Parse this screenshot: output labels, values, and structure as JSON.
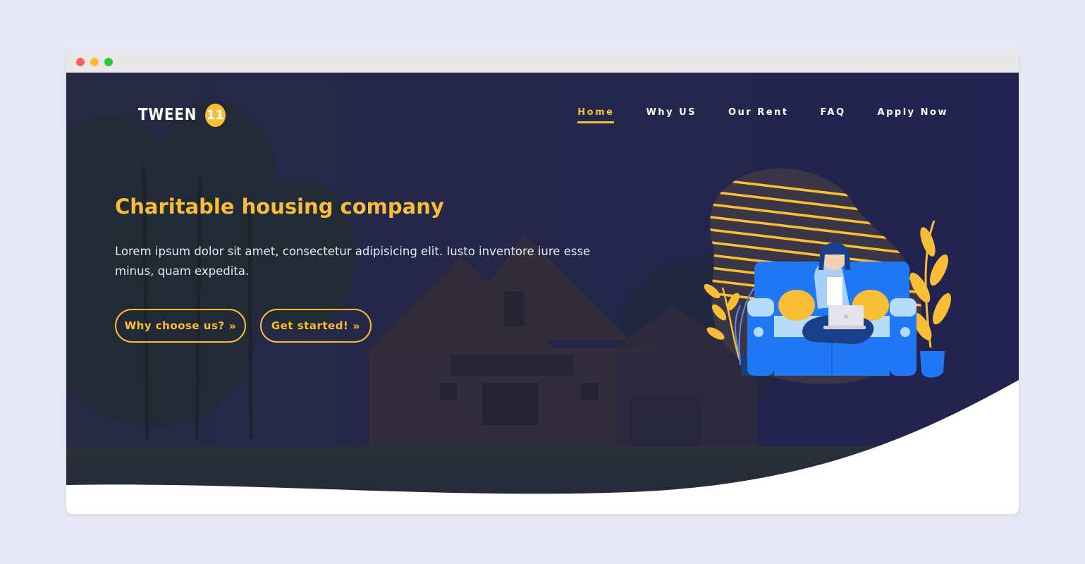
{
  "window": {
    "controls": [
      "close",
      "minimize",
      "maximize"
    ]
  },
  "header": {
    "logo_text": "TWEEN",
    "logo_badge": "11",
    "nav": [
      {
        "label": "Home",
        "active": true
      },
      {
        "label": "Why US",
        "active": false
      },
      {
        "label": "Our Rent",
        "active": false
      },
      {
        "label": "FAQ",
        "active": false
      },
      {
        "label": "Apply Now",
        "active": false
      }
    ]
  },
  "hero": {
    "title": "Charitable housing company",
    "description": "Lorem ipsum dolor sit amet, consectetur adipisicing elit. Iusto inventore iure esse minus, quam expedita.",
    "buttons": {
      "why_label": "Why choose us?",
      "start_label": "Get started!"
    },
    "icons": {
      "button_arrow": "double-chevron-right-icon",
      "illustration": "woman-on-sofa-with-laptop-illustration"
    }
  },
  "colors": {
    "accent": "#f9be37",
    "overlay": "#1f1f4d",
    "page_background": "#e6e8f6",
    "sofa": "#2178f5"
  }
}
